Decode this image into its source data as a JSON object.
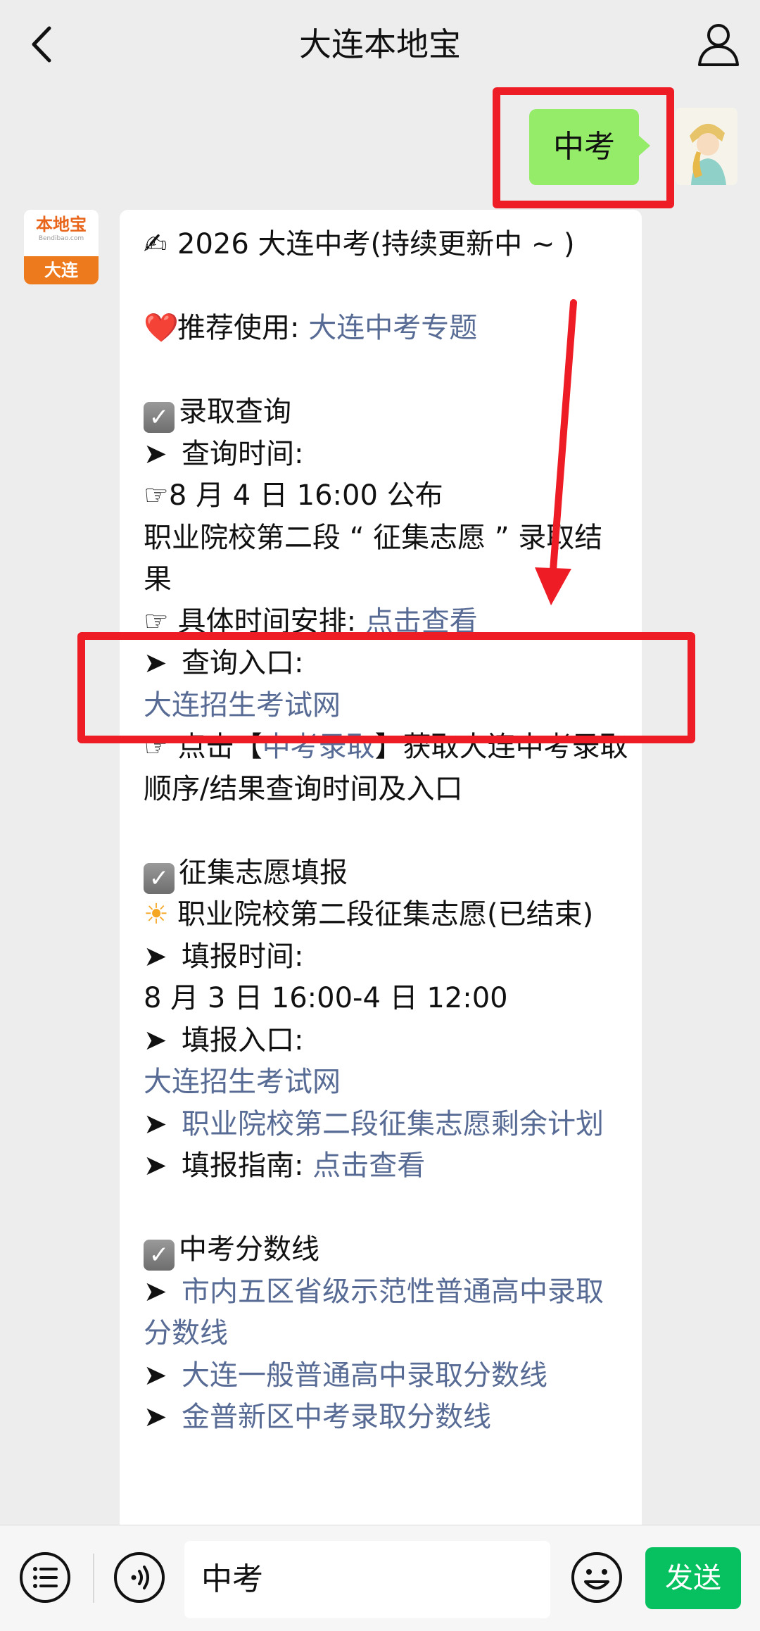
{
  "header": {
    "title": "大连本地宝"
  },
  "outgoing": {
    "text": "中考"
  },
  "bot_avatar": {
    "logo": "本地宝",
    "site": "Bendibao.com",
    "city": "大连"
  },
  "message": {
    "title_emoji": "✍",
    "title": "2026 大连中考(持续更新中 ~ )",
    "recommend_emoji": "❤️",
    "recommend_label": "推荐使用:",
    "recommend_link": "大连中考专题",
    "sec1_title": "录取查询",
    "sec1_l1": "查询时间:",
    "sec1_l2": "8 月 4 日 16:00 公布",
    "sec1_l3": "职业院校第二段 “ 征集志愿 ” 录取结果",
    "sec1_l4_label": "具体时间安排:",
    "sec1_l4_link": "点击查看",
    "sec1_l5": "查询入口:",
    "sec1_l6_link": "大连招生考试网",
    "sec1_l7_pre": "点击【",
    "sec1_l7_link": "中考录取",
    "sec1_l7_post": "】获取大连中考录取顺序/结果查询时间及入口",
    "sec2_title": "征集志愿填报",
    "sec2_l1": "职业院校第二段征集志愿(已结束)",
    "sec2_l2": "填报时间:",
    "sec2_l3": "8 月 3 日 16:00-4 日 12:00",
    "sec2_l4": "填报入口:",
    "sec2_l5_link": "大连招生考试网",
    "sec2_l6_link": "职业院校第二段征集志愿剩余计划",
    "sec2_l7_label": "填报指南:",
    "sec2_l7_link": "点击查看",
    "sec3_title": "中考分数线",
    "sec3_l1_link": "市内五区省级示范性普通高中录取分数线",
    "sec3_l2_link": "大连一般普通高中录取分数线",
    "sec3_l3_link": "金普新区中考录取分数线"
  },
  "inputbar": {
    "value": "中考",
    "send_label": "发送"
  },
  "colors": {
    "accent_green": "#07c160",
    "bubble_green": "#95ec69",
    "link": "#576b95",
    "annotation_red": "#ee1c25"
  }
}
